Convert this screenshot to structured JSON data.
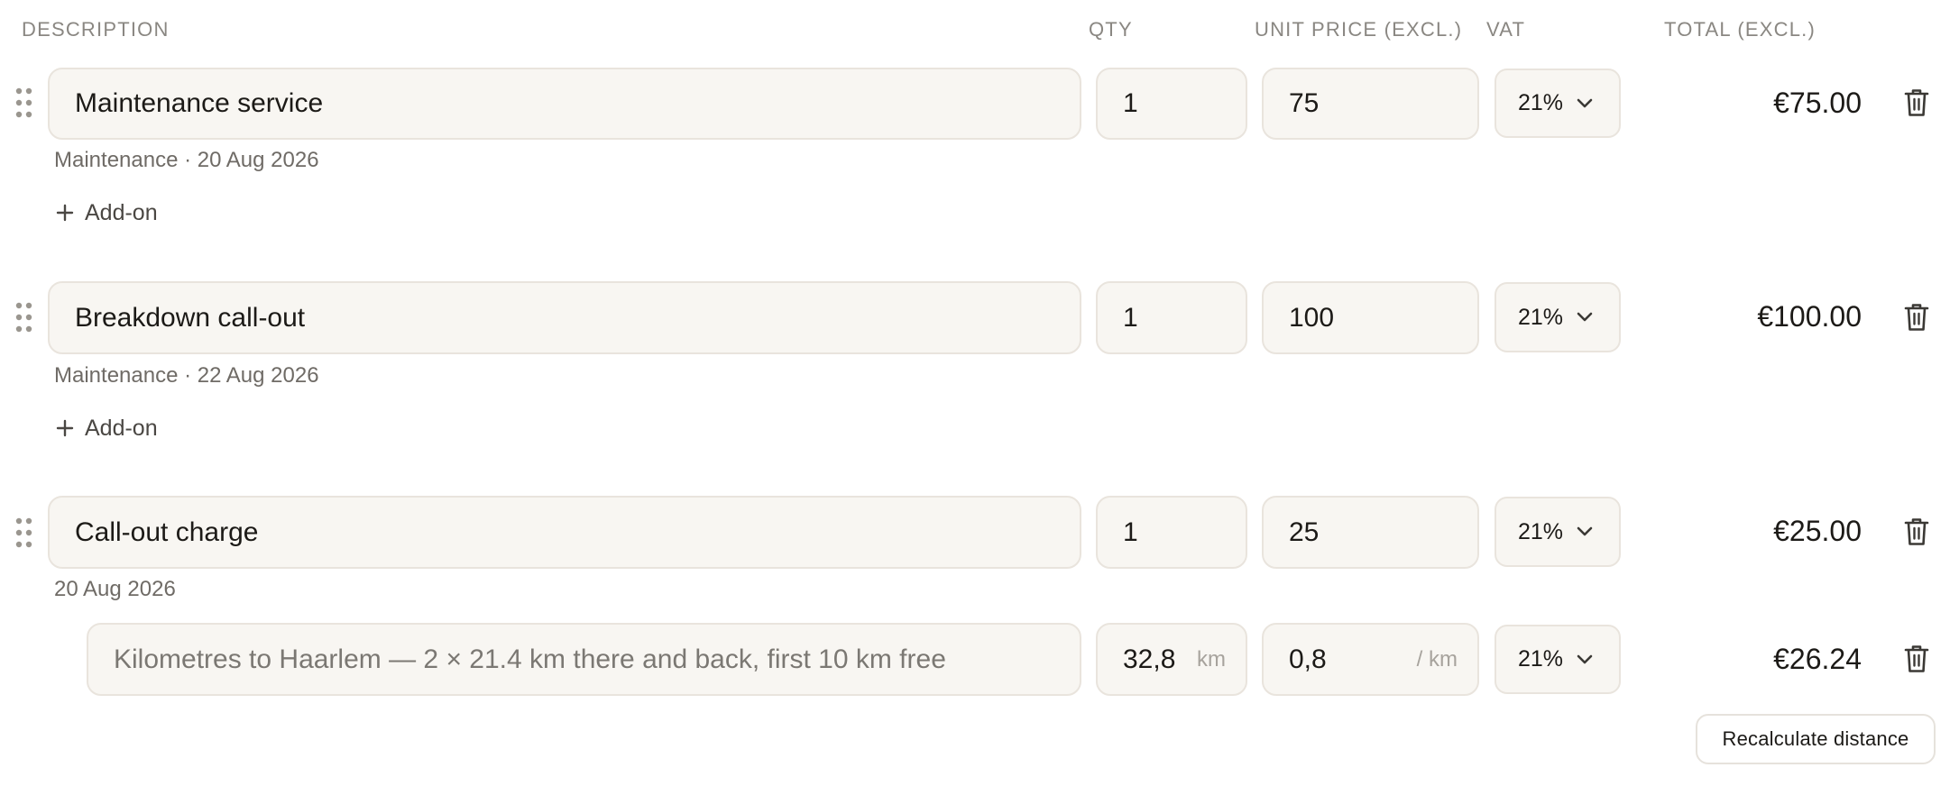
{
  "columns": {
    "description": "DESCRIPTION",
    "qty": "QTY",
    "unit_price": "UNIT PRICE (EXCL.)",
    "vat": "VAT",
    "total": "TOTAL (EXCL.)"
  },
  "lines": [
    {
      "description": "Maintenance service",
      "qty": "1",
      "unit_price": "75",
      "vat": "21%",
      "total": "€75.00",
      "meta": "Maintenance · 20 Aug 2026",
      "addon_label": "Add-on"
    },
    {
      "description": "Breakdown call-out",
      "qty": "1",
      "unit_price": "100",
      "vat": "21%",
      "total": "€100.00",
      "meta": "Maintenance · 22 Aug 2026",
      "addon_label": "Add-on"
    },
    {
      "description": "Call-out charge",
      "qty": "1",
      "unit_price": "25",
      "vat": "21%",
      "total": "€25.00",
      "meta": "20 Aug 2026"
    }
  ],
  "distance_line": {
    "description": "Kilometres to Haarlem — 2 × 21.4 km there and back, first 10 km free",
    "qty": "32,8",
    "qty_unit": "km",
    "unit_price": "0,8",
    "price_unit": "/ km",
    "vat": "21%",
    "total": "€26.24"
  },
  "recalculate_label": "Recalculate distance",
  "icons": {
    "drag": "drag-handle-icon",
    "trash": "trash-icon",
    "chevron": "chevron-down-icon",
    "plus": "plus-icon"
  }
}
